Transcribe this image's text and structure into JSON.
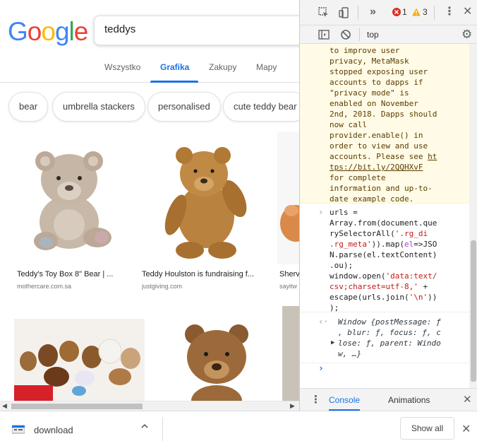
{
  "google": {
    "logo_letters": [
      {
        "ch": "G",
        "color": "#4285F4"
      },
      {
        "ch": "o",
        "color": "#EA4335"
      },
      {
        "ch": "o",
        "color": "#FBBC05"
      },
      {
        "ch": "g",
        "color": "#4285F4"
      },
      {
        "ch": "l",
        "color": "#34A853"
      },
      {
        "ch": "e",
        "color": "#EA4335"
      }
    ],
    "search_value": "teddys",
    "tabs": [
      "Wszystko",
      "Grafika",
      "Zakupy",
      "Mapy"
    ],
    "active_tab": "Grafika",
    "chips": [
      "bear",
      "umbrella stackers",
      "personalised",
      "cute teddy bear"
    ],
    "results": [
      {
        "caption": "Teddy's Toy Box 8\" Bear | ...",
        "source": "mothercare.com.sa"
      },
      {
        "caption": "Teddy Houlston is fundraising f...",
        "source": "justgiving.com"
      },
      {
        "caption": "Sherv",
        "source": "sayitw"
      }
    ]
  },
  "devtools": {
    "top_context": "top",
    "error_count": "1",
    "warning_count": "3",
    "warning_lines": [
      "to improve user",
      "privacy, MetaMask",
      "stopped exposing user",
      "accounts to dapps if",
      "\"privacy mode\" is",
      "enabled on November",
      "2nd, 2018. Dapps should",
      "now call",
      "provider.enable() in",
      "order to view and use",
      "accounts. Please see "
    ],
    "warning_link_1": "ht",
    "warning_link_2": "tps://bit.ly/2QQHXvF",
    "warning_tail": [
      "for complete",
      "information and up-to-",
      "date example code."
    ],
    "result_lines": [
      "Window {postMessage: ƒ",
      ", blur: ƒ, focus: ƒ, c",
      "lose: ƒ, parent: Windo",
      "w, …}"
    ],
    "drawer_tabs": [
      "Console",
      "Animations"
    ],
    "icons": [
      "inspect-icon",
      "device-toolbar-icon",
      "more-panels-icon",
      "error-icon",
      "warning-icon",
      "kebab-menu-icon",
      "close-icon",
      "sidebar-toggle-icon",
      "clear-console-icon",
      "settings-icon"
    ]
  },
  "download_bar": {
    "item_label": "download",
    "show_all_label": "Show all"
  }
}
